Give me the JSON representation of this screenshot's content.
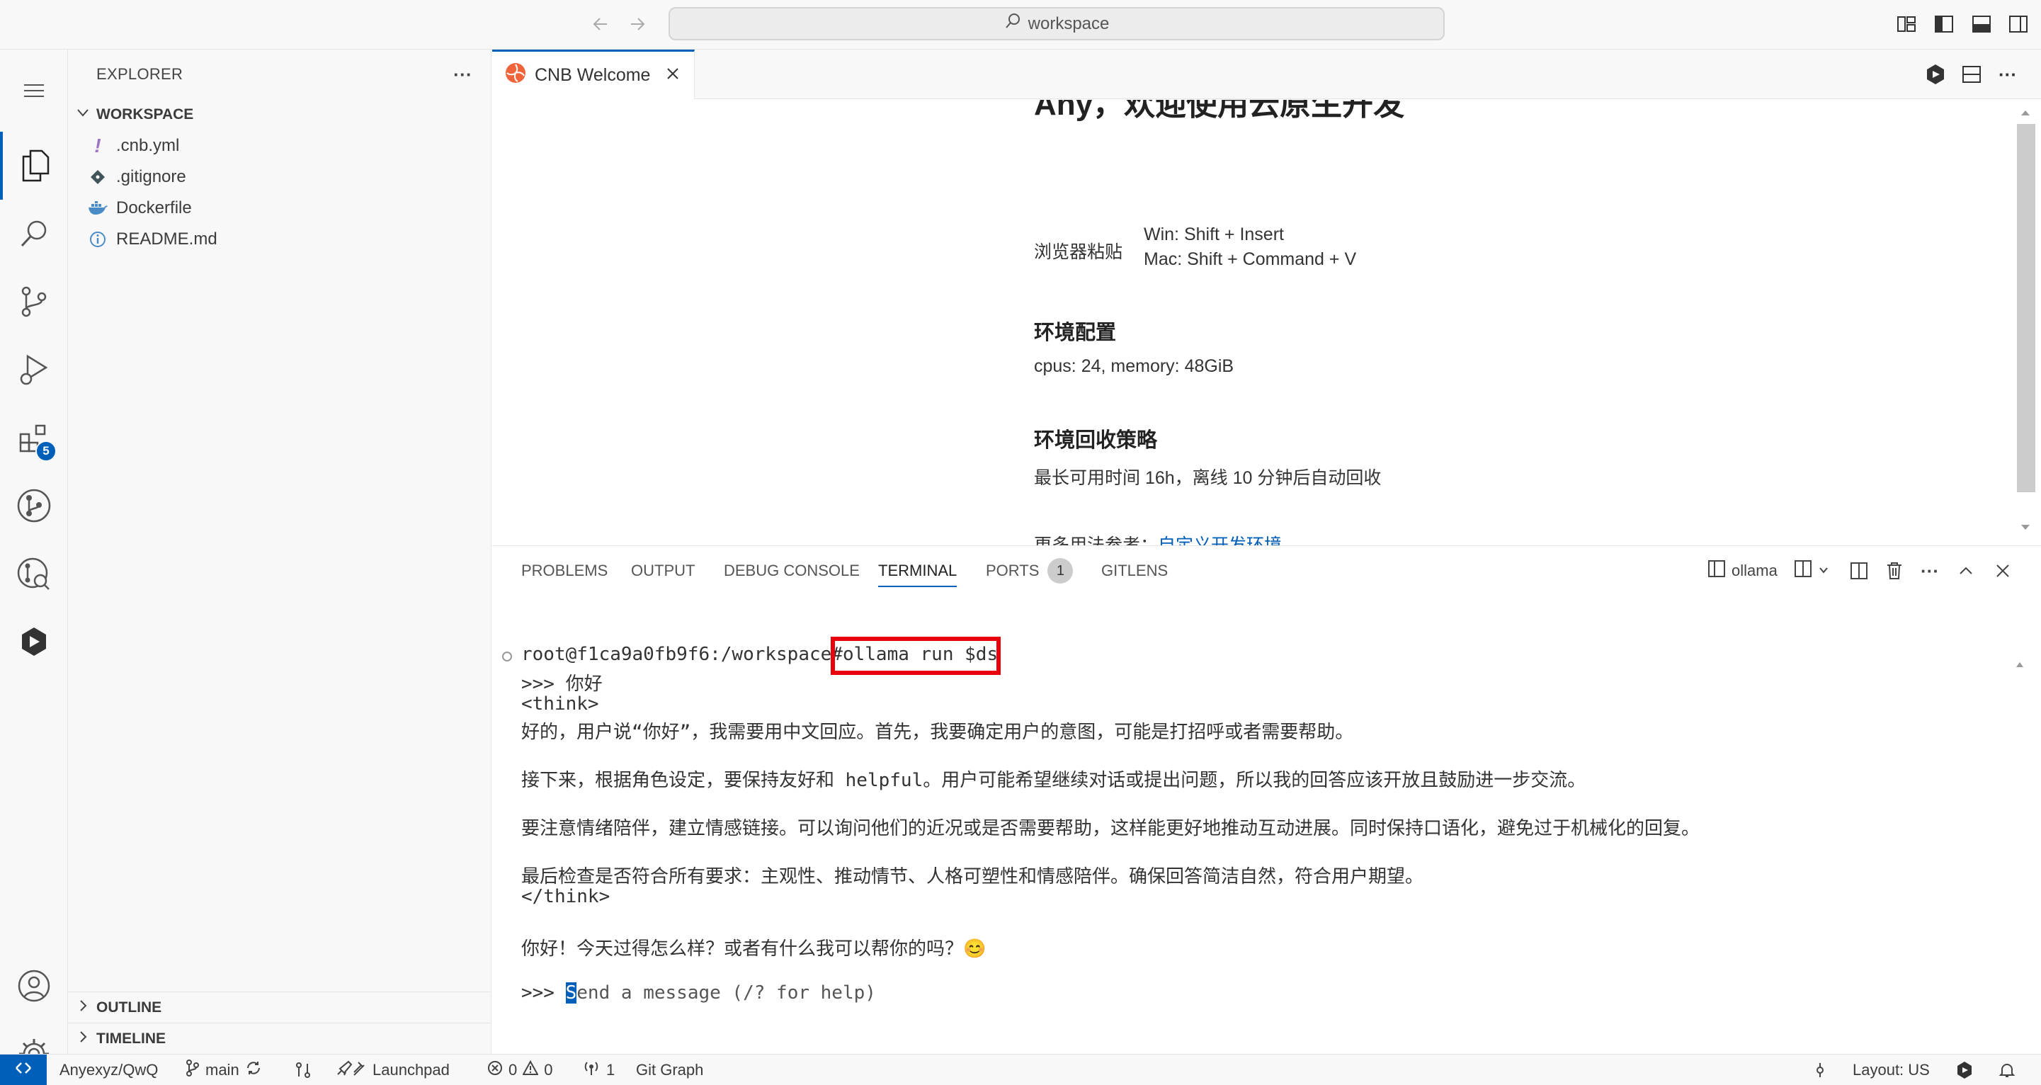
{
  "titlebar": {
    "search_text": "workspace",
    "icons": [
      "arrow-left-icon",
      "arrow-right-icon",
      "search-icon",
      "customize-layout-icon",
      "toggle-sidebar-icon",
      "toggle-panel-icon",
      "toggle-secondary-sidebar-icon"
    ]
  },
  "activitybar": {
    "items": [
      "explorer",
      "search",
      "source-control",
      "run-debug",
      "extensions",
      "git-graph",
      "gitlens-inspect",
      "cnb"
    ],
    "extensions_badge": "5"
  },
  "sidebar": {
    "title": "EXPLORER",
    "more": "···",
    "workspace": "WORKSPACE",
    "files": [
      {
        "name": ".cnb.yml",
        "icon": "yaml-icon"
      },
      {
        "name": ".gitignore",
        "icon": "git-icon"
      },
      {
        "name": "Dockerfile",
        "icon": "docker-icon"
      },
      {
        "name": "README.md",
        "icon": "info-icon"
      }
    ],
    "outline": "OUTLINE",
    "timeline": "TIMELINE"
  },
  "editor": {
    "tab_label": "CNB Welcome",
    "partial_heading": "Any，欢迎使用云原生开发",
    "paste_label": "浏览器粘贴",
    "paste_win": "Win: Shift  +  Insert",
    "paste_mac": "Mac: Shift  +  Command  +  V",
    "env_heading": "环境配置",
    "env_text": "cpus: 24, memory: 48GiB",
    "recycle_heading": "环境回收策略",
    "recycle_text": "最长可用时间 16h，离线 10 分钟后自动回收",
    "more_label": "更多用法参考：",
    "more_link": "自定义开发环境"
  },
  "panel": {
    "tabs": [
      "PROBLEMS",
      "OUTPUT",
      "DEBUG CONSOLE",
      "TERMINAL",
      "PORTS",
      "GITLENS"
    ],
    "active_tab": "TERMINAL",
    "ports_count": "1",
    "terminal_name": "ollama"
  },
  "terminal": {
    "prompt": "root@f1ca9a0fb9f6:/workspace#",
    "command": "ollama run $ds",
    "lines": [
      ">>> 你好",
      "<think>",
      "好的，用户说“你好”，我需要用中文回应。首先，我要确定用户的意图，可能是打招呼或者需要帮助。",
      "",
      "接下来，根据角色设定，要保持友好和 helpful。用户可能希望继续对话或提出问题，所以我的回答应该开放且鼓励进一步交流。",
      "",
      "要注意情绪陪伴，建立情感链接。可以询问他们的近况或是否需要帮助，这样能更好地推动互动进展。同时保持口语化，避免过于机械化的回复。",
      "",
      "最后检查是否符合所有要求：主观性、推动情节、人格可塑性和情感陪伴。确保回答简洁自然，符合用户期望。",
      "</think>",
      "",
      "你好！今天过得怎么样？或者有什么我可以帮你的吗？😊"
    ],
    "input_prefix": ">>> ",
    "input_cursor_char": "S",
    "input_placeholder": "end a message (/? for help)"
  },
  "statusbar": {
    "repo": "Anyexyz/QwQ",
    "branch": "main",
    "launchpad": "Launchpad",
    "errors": "0",
    "warnings": "0",
    "ports": "1",
    "git_graph": "Git Graph",
    "layout": "Layout: US"
  },
  "colors": {
    "accent": "#005fb8",
    "highlight_border": "#e8000b",
    "link": "#005fb8"
  }
}
